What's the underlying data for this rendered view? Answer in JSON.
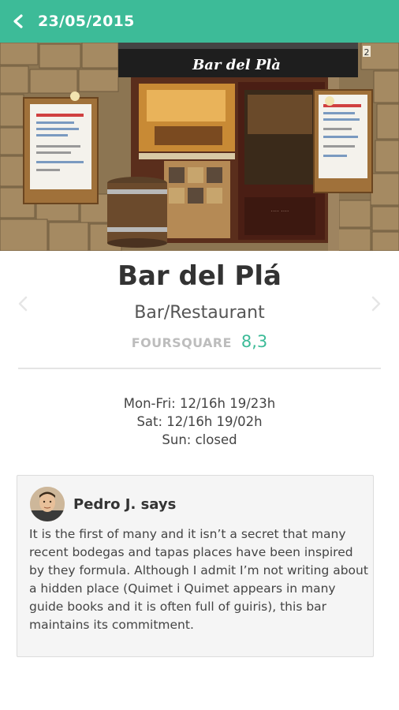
{
  "header": {
    "title": "23/05/2015",
    "back_icon": "chevron-left-icon",
    "background_color": "#3dbb98"
  },
  "hero": {
    "sign_text": "Bar del Plà",
    "house_number": "2"
  },
  "venue": {
    "name": "Bar del Plá",
    "category": "Bar/Restaurant",
    "rating_source": "FOURSQUARE",
    "rating_value": "8,3",
    "accent_color": "#3dbb98"
  },
  "navigation": {
    "prev_icon": "chevron-left-icon",
    "next_icon": "chevron-right-icon"
  },
  "hours": [
    "Mon-Fri: 12/16h 19/23h",
    "Sat: 12/16h 19/02h",
    "Sun: closed"
  ],
  "review": {
    "author": "Pedro J. says",
    "text": "It is the first of many and it isn’t a secret that many recent bodegas and tapas places have been inspired by they formula. Although I admit I’m not writing about a hidden place (Quimet i Quimet appears in many guide books and it is often full of guiris), this bar maintains its commitment."
  }
}
